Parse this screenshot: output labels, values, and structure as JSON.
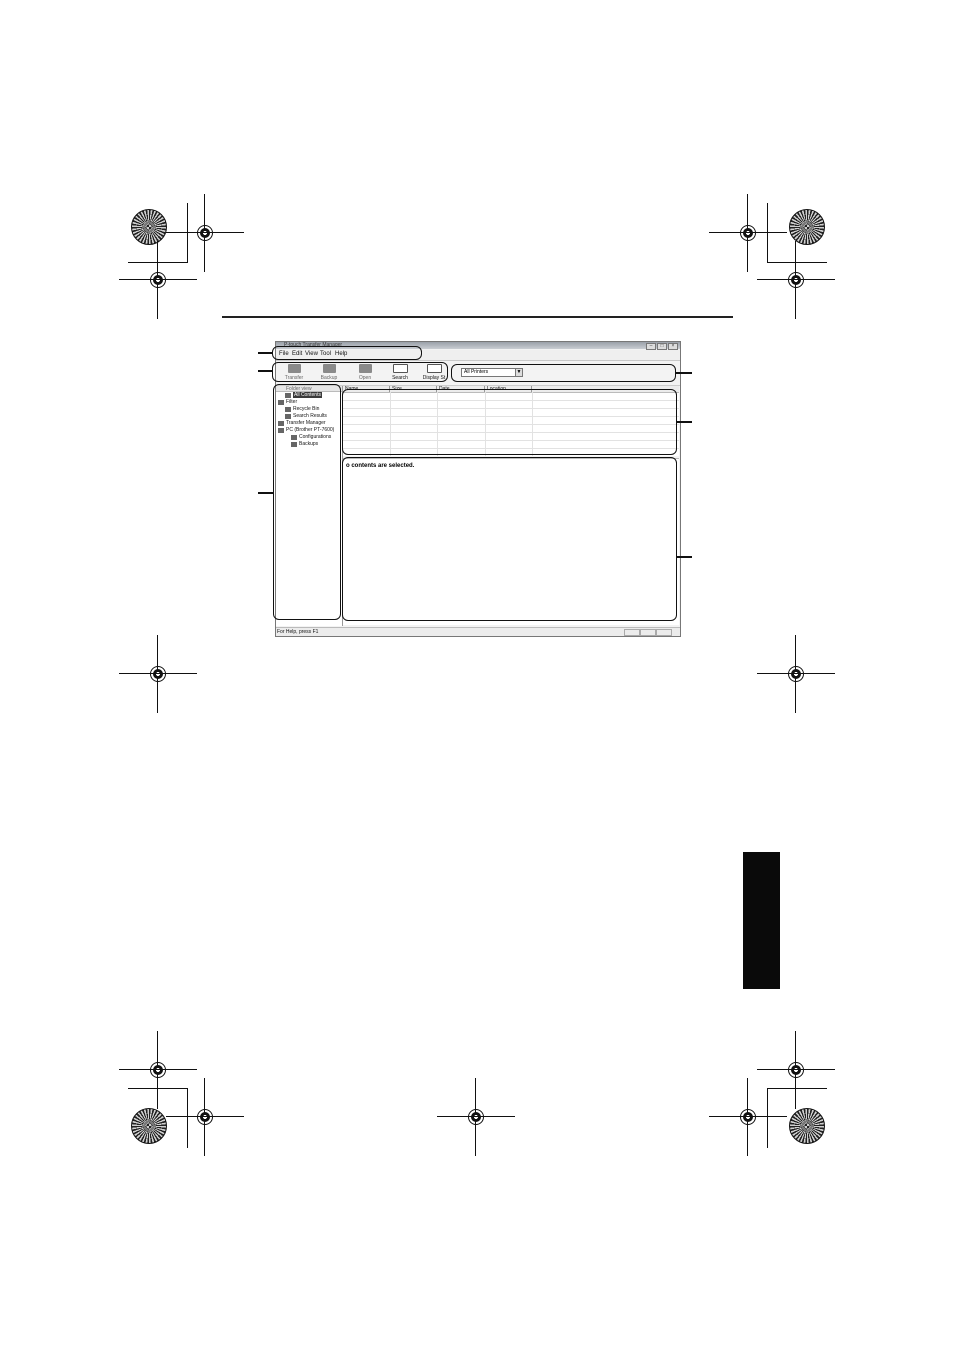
{
  "app": {
    "window_title": "P-touch Transfer Manager",
    "window_buttons": [
      "–",
      "□",
      "×"
    ],
    "menu": [
      "File",
      "Edit",
      "View",
      "Tool",
      "Help"
    ],
    "toolbar": [
      {
        "label": "Transfer",
        "icon": "transfer-icon",
        "enabled": false
      },
      {
        "label": "Backup",
        "icon": "backup-icon",
        "enabled": false
      },
      {
        "label": "Open",
        "icon": "open-folder-icon",
        "enabled": false
      },
      {
        "label": "Search",
        "icon": "search-icon",
        "enabled": true
      },
      {
        "label": "Display St",
        "icon": "display-style-icon",
        "enabled": true
      }
    ],
    "printer_select": {
      "value": "All Printers"
    },
    "tree": {
      "header": "Folder view",
      "items": [
        {
          "label": "All Contents",
          "selected": true
        },
        {
          "label": "Filter"
        },
        {
          "label": "Recycle Bin"
        },
        {
          "label": "Search Results"
        },
        {
          "label": "Transfer Manager"
        },
        {
          "label": "PC (Brother PT-7600)"
        },
        {
          "label": "Configurations"
        },
        {
          "label": "Backups"
        }
      ]
    },
    "list": {
      "columns": [
        "Name",
        "Size",
        "Date",
        "Location"
      ]
    },
    "preview_message": "o contents are selected.",
    "status_text": "For Help, press F1"
  },
  "colors": {
    "side_tab": "#0a0a0a",
    "selection": "#3b3b3b"
  }
}
